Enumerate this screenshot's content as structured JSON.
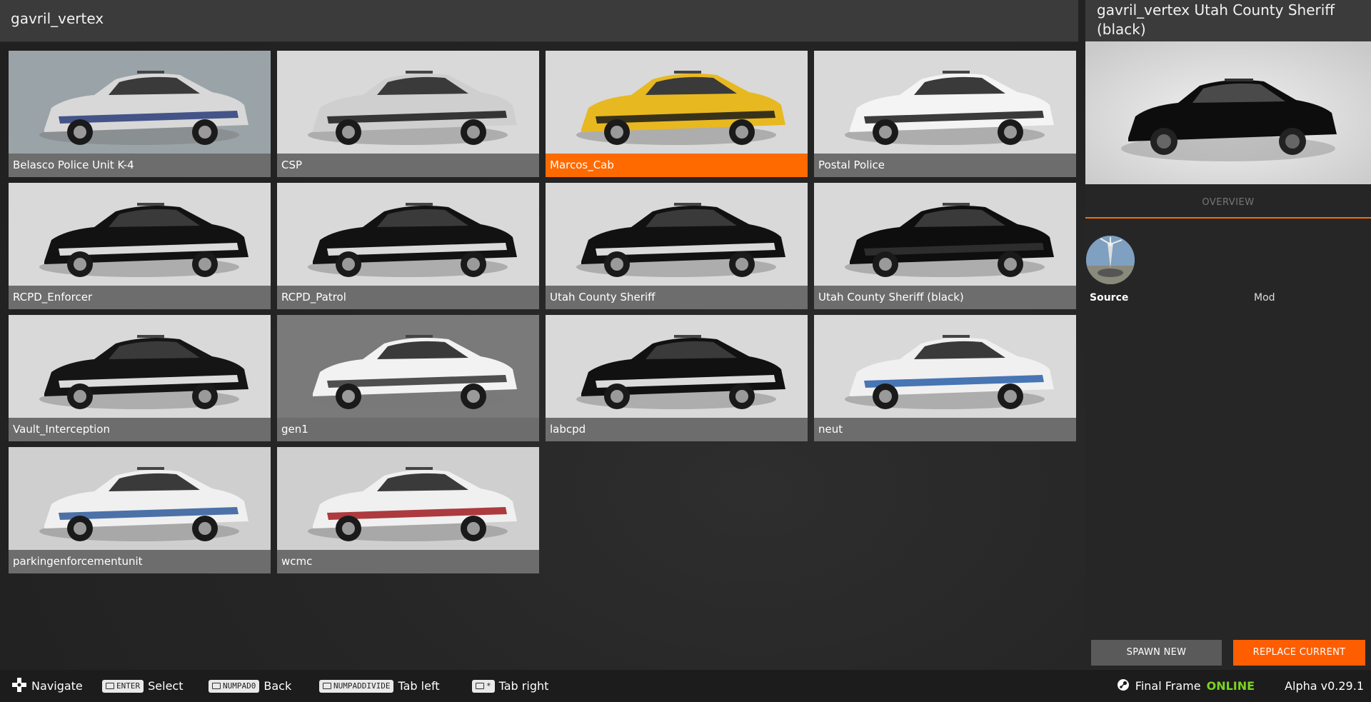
{
  "header": {
    "title": "gavril_vertex"
  },
  "tiles": [
    {
      "label": "Belasco Police Unit K-4",
      "body": "#d8d8d8",
      "accent": "#2a3d7a",
      "bg": "#9aa3a8"
    },
    {
      "label": "CSP",
      "body": "#cfcfcf",
      "accent": "#1a1a1a",
      "bg": "#d9d9d9"
    },
    {
      "label": "Marcos_Cab",
      "body": "#e8b820",
      "accent": "#1a1a1a",
      "bg": "#d9d9d9"
    },
    {
      "label": "Postal Police",
      "body": "#f4f4f4",
      "accent": "#1a1a1a",
      "bg": "#d9d9d9"
    },
    {
      "label": "RCPD_Enforcer",
      "body": "#121212",
      "accent": "#ffffff",
      "bg": "#d9d9d9"
    },
    {
      "label": "RCPD_Patrol",
      "body": "#121212",
      "accent": "#ffffff",
      "bg": "#d9d9d9"
    },
    {
      "label": "Utah County Sheriff",
      "body": "#111111",
      "accent": "#ffffff",
      "bg": "#d9d9d9"
    },
    {
      "label": "Utah County Sheriff (black)",
      "body": "#0e0e0e",
      "accent": "#333333",
      "bg": "#d9d9d9"
    },
    {
      "label": "Vault_Interception",
      "body": "#151515",
      "accent": "#ffffff",
      "bg": "#d9d9d9"
    },
    {
      "label": "gen1",
      "body": "#f2f2f2",
      "accent": "#333333",
      "bg": "#7a7a7a"
    },
    {
      "label": "labcpd",
      "body": "#111111",
      "accent": "#ffffff",
      "bg": "#d9d9d9"
    },
    {
      "label": "neut",
      "body": "#f0f0f0",
      "accent": "#2a5fa8",
      "bg": "#d9d9d9"
    },
    {
      "label": "parkingenforcementunit",
      "body": "#f0f0f0",
      "accent": "#2e5b9a",
      "bg": "#cfcfcf"
    },
    {
      "label": "wcmc",
      "body": "#f0f0f0",
      "accent": "#a01a20",
      "bg": "#cfcfcf"
    }
  ],
  "selected_index": 2,
  "panel": {
    "title": "gavril_vertex Utah County Sheriff (black)",
    "tab": "OVERVIEW",
    "source_label": "Source",
    "source_value": "Mod",
    "spawn_label": "SPAWN NEW",
    "replace_label": "REPLACE CURRENT"
  },
  "footer": {
    "navigate": "Navigate",
    "enter_key": "ENTER",
    "select": "Select",
    "back_key": "NUMPAD0",
    "back": "Back",
    "tableft_key": "NUMPADDIVIDE",
    "tableft": "Tab left",
    "tabright_key": "*",
    "tabright": "Tab right",
    "server": "Final Frame",
    "status": "ONLINE",
    "version": "Alpha v0.29.1"
  },
  "colors": {
    "accent": "#ff6a00",
    "online": "#7bd321"
  }
}
